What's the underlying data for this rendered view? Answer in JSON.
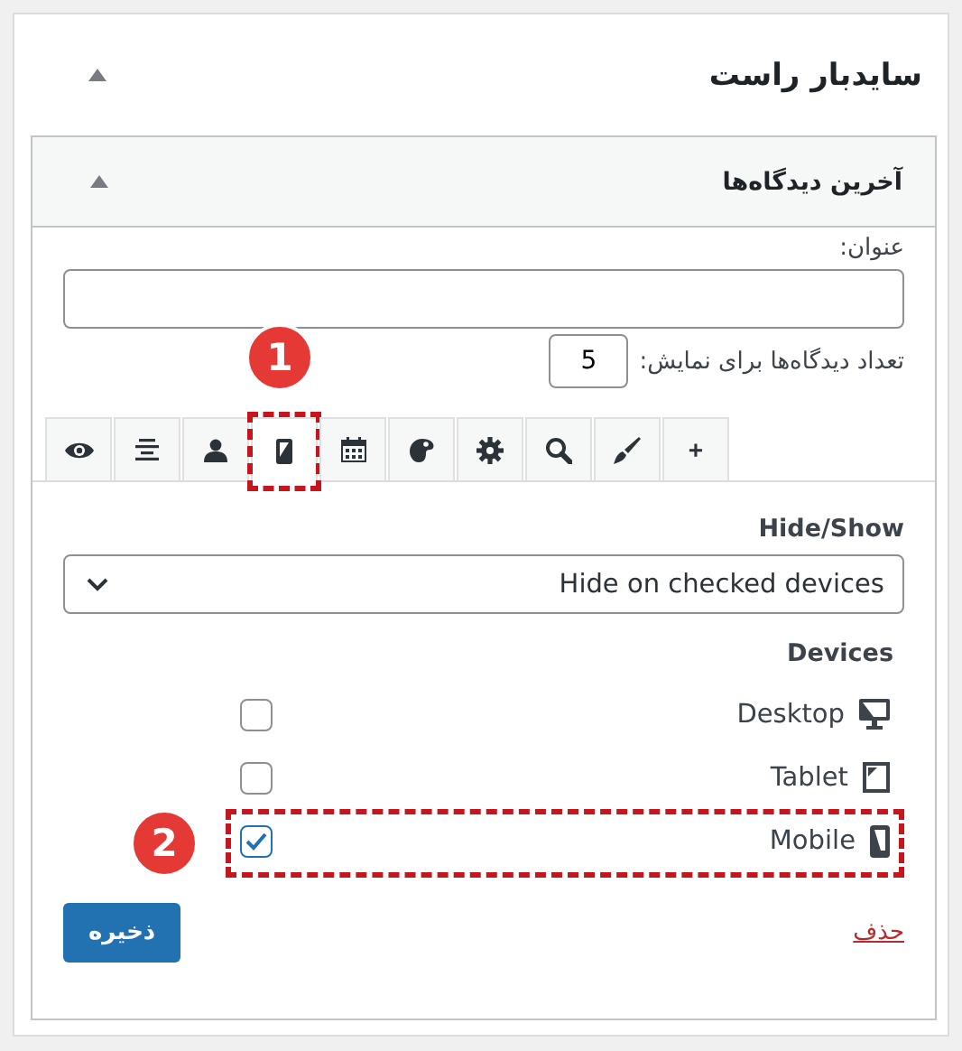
{
  "panel": {
    "title": "سایدبار راست",
    "expanded": true
  },
  "widget": {
    "title": "آخرین دیدگاه‌ها",
    "expanded": true
  },
  "title_field": {
    "label": "عنوان:"
  },
  "count_field": {
    "label": "تعداد دیدگاه‌ها برای نمایش:",
    "value": "5"
  },
  "tabs": [
    {
      "kind": "visibility",
      "selected": false
    },
    {
      "kind": "alignment",
      "selected": false
    },
    {
      "kind": "user",
      "selected": false
    },
    {
      "kind": "device",
      "selected": true,
      "marker": "1"
    },
    {
      "kind": "calendar",
      "selected": false
    },
    {
      "kind": "palette",
      "selected": false
    },
    {
      "kind": "settings",
      "selected": false
    },
    {
      "kind": "search",
      "selected": false
    },
    {
      "kind": "brush",
      "selected": false
    },
    {
      "kind": "add",
      "selected": false,
      "label": "+"
    }
  ],
  "hide_show": {
    "label": "Hide/Show",
    "value": "Hide on checked devices"
  },
  "devices": {
    "label": "Devices",
    "items": [
      {
        "kind": "desktop",
        "label": "Desktop",
        "checked": false
      },
      {
        "kind": "tablet",
        "label": "Tablet",
        "checked": false
      },
      {
        "kind": "mobile",
        "label": "Mobile",
        "checked": true,
        "marker": "2"
      }
    ]
  },
  "delete_link": "حذف",
  "save_button": "ذخیره"
}
